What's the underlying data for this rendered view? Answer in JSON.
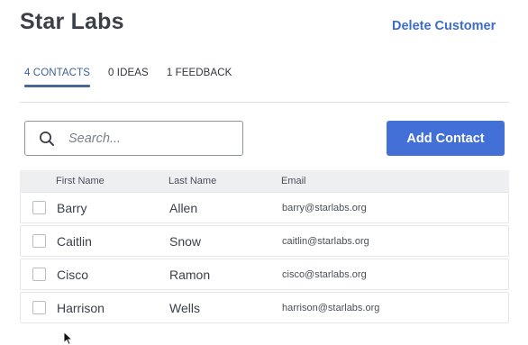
{
  "header": {
    "title": "Star Labs",
    "delete_label": "Delete Customer"
  },
  "tabs": [
    {
      "label": "4 CONTACTS",
      "active": true
    },
    {
      "label": "0 IDEAS",
      "active": false
    },
    {
      "label": "1 FEEDBACK",
      "active": false
    }
  ],
  "search": {
    "placeholder": "Search...",
    "icon": "search-icon"
  },
  "add_contact_label": "Add Contact",
  "table": {
    "columns": [
      "First Name",
      "Last Name",
      "Email"
    ],
    "rows": [
      {
        "first": "Barry",
        "last": "Allen",
        "email": "barry@starlabs.org"
      },
      {
        "first": "Caitlin",
        "last": "Snow",
        "email": "caitlin@starlabs.org"
      },
      {
        "first": "Cisco",
        "last": "Ramon",
        "email": "cisco@starlabs.org"
      },
      {
        "first": "Harrison",
        "last": "Wells",
        "email": "harrison@starlabs.org"
      }
    ]
  },
  "colors": {
    "accent": "#4270d6",
    "link": "#3d6ccf",
    "tab_active": "#3d5f9e"
  }
}
